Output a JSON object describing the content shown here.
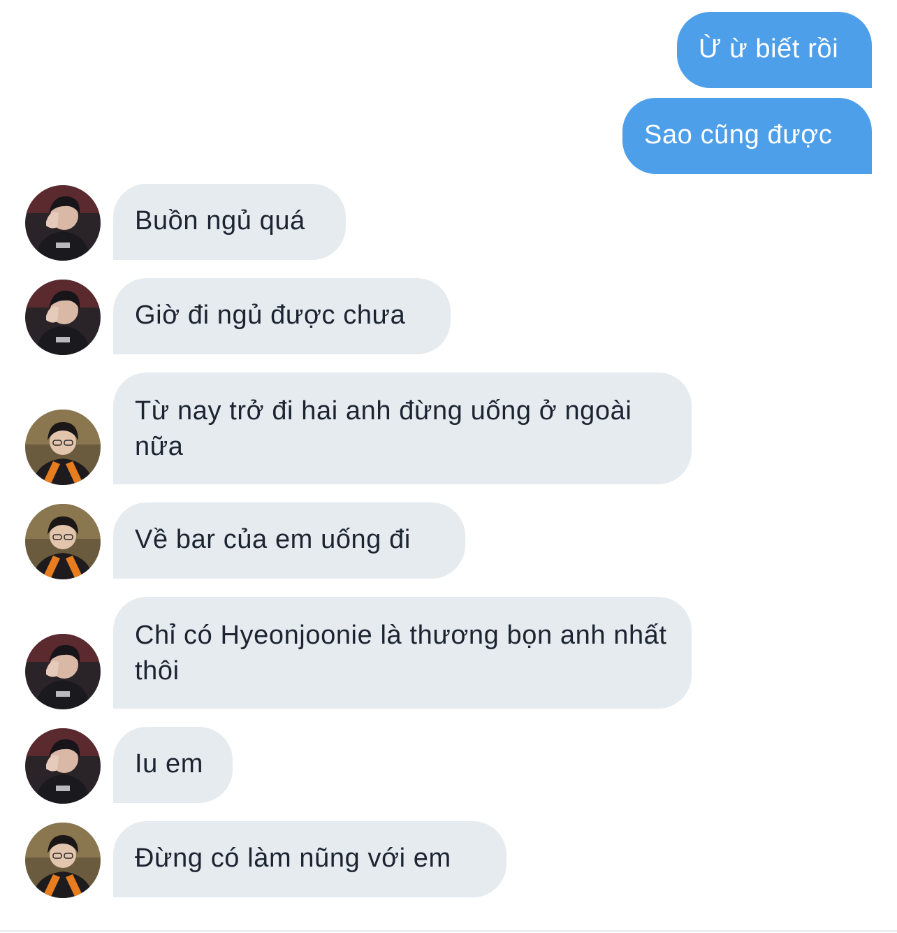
{
  "conversation": {
    "messages": [
      {
        "direction": "sent",
        "text": "Ừ ừ biết rồi"
      },
      {
        "direction": "sent",
        "text": "Sao cũng được"
      },
      {
        "direction": "received",
        "sender_avatar": "avatar-dark-jacket",
        "text": "Buồn ngủ quá"
      },
      {
        "direction": "received",
        "sender_avatar": "avatar-dark-jacket",
        "text": "Giờ đi ngủ được chưa"
      },
      {
        "direction": "received",
        "sender_avatar": "avatar-orange-collar",
        "text": "Từ nay trở đi hai anh đừng uống ở ngoài nữa"
      },
      {
        "direction": "received",
        "sender_avatar": "avatar-orange-collar",
        "text": "Về bar của em uống đi"
      },
      {
        "direction": "received",
        "sender_avatar": "avatar-dark-jacket",
        "text": "Chỉ có Hyeonjoonie là thương bọn anh nhất thôi"
      },
      {
        "direction": "received",
        "sender_avatar": "avatar-dark-jacket",
        "text": "Iu em"
      },
      {
        "direction": "received",
        "sender_avatar": "avatar-orange-collar",
        "text": "Đừng có làm nũng với em"
      }
    ]
  },
  "colors": {
    "sent_bubble": "#4d9fea",
    "sent_text": "#ffffff",
    "received_bubble": "#e6ebf0",
    "received_text": "#1b2430",
    "background": "#ffffff"
  }
}
